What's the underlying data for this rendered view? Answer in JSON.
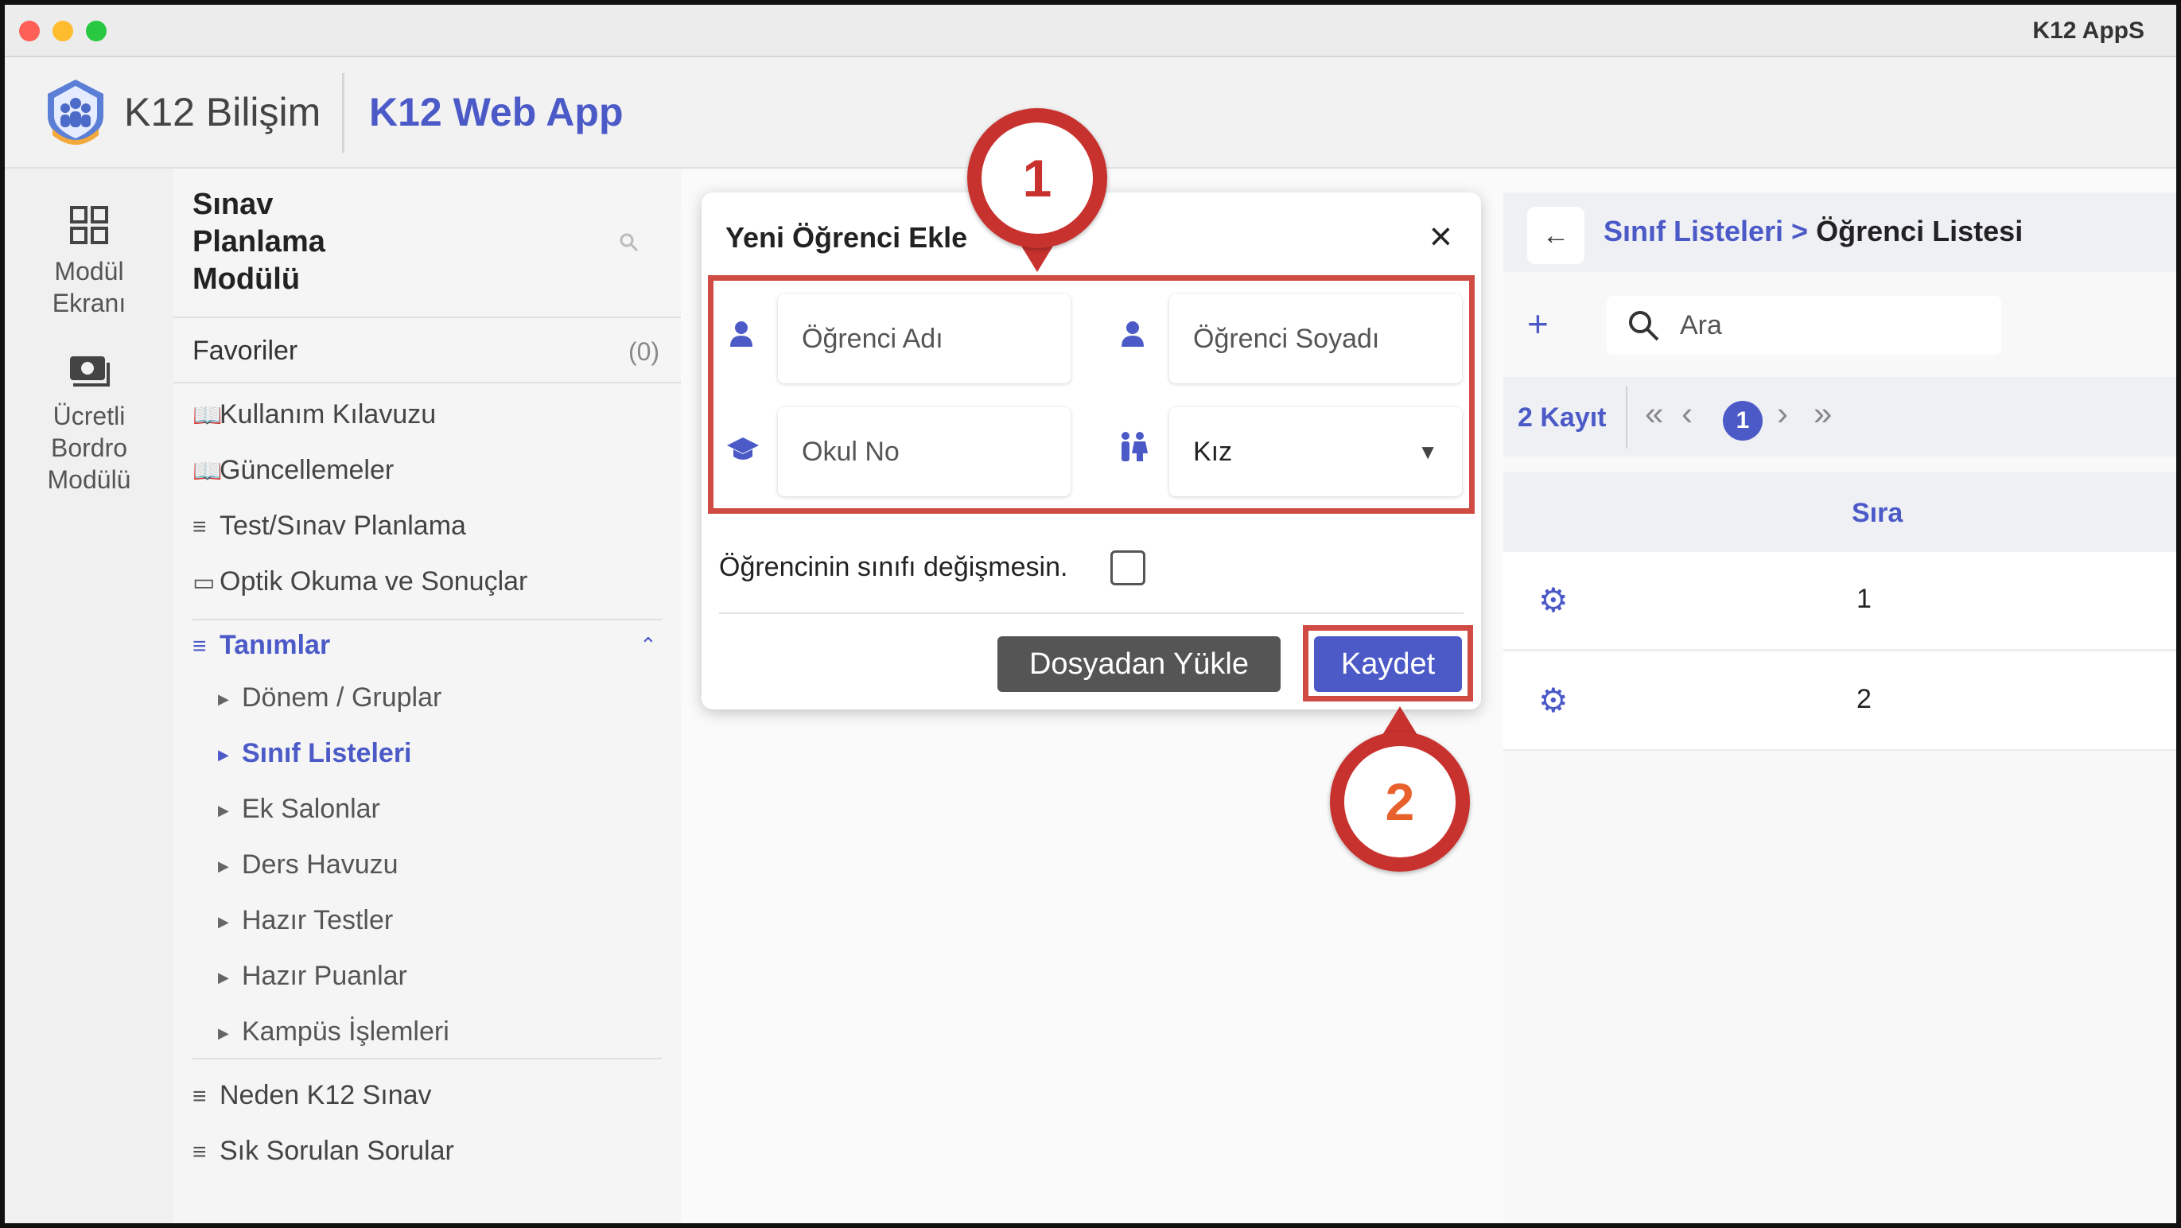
{
  "window": {
    "app_title": "K12 AppS",
    "traffic_lights": [
      "#fe5f57",
      "#febc2e",
      "#28c840"
    ]
  },
  "header": {
    "brand": "K12 Bilişim",
    "app_name": "K12 Web App"
  },
  "rail": {
    "items": [
      {
        "label_line1": "Modül",
        "label_line2": "Ekranı",
        "icon": "grid-icon"
      },
      {
        "label_line1": "Ücretli",
        "label_line2": "Bordro",
        "label_line3": "Modülü",
        "icon": "payroll-icon"
      }
    ]
  },
  "sidebar": {
    "title_line1": "Sınav",
    "title_line2": "Planlama",
    "title_line3": "Modülü",
    "favorites_label": "Favoriler",
    "favorites_count": "(0)",
    "items": [
      {
        "label": "Kullanım Kılavuzu"
      },
      {
        "label": "Güncellemeler"
      },
      {
        "label": "Test/Sınav Planlama"
      },
      {
        "label": "Optik Okuma ve Sonuçlar"
      }
    ],
    "section": {
      "label": "Tanımlar",
      "children": [
        {
          "label": "Dönem / Gruplar"
        },
        {
          "label": "Sınıf Listeleri"
        },
        {
          "label": "Ek Salonlar"
        },
        {
          "label": "Ders Havuzu"
        },
        {
          "label": "Hazır Testler"
        },
        {
          "label": "Hazır Puanlar"
        },
        {
          "label": "Kampüs İşlemleri"
        }
      ]
    },
    "bottom_items": [
      {
        "label": "Neden K12 Sınav"
      },
      {
        "label": "Sık Sorulan Sorular"
      }
    ]
  },
  "modal": {
    "title": "Yeni Öğrenci Ekle",
    "first_name_placeholder": "Öğrenci Adı",
    "last_name_placeholder": "Öğrenci Soyadı",
    "school_no_placeholder": "Okul No",
    "gender_value": "Kız",
    "checkbox_label": "Öğrencinin sınıfı değişmesin.",
    "upload_button": "Dosyadan Yükle",
    "save_button": "Kaydet"
  },
  "right_panel": {
    "crumb_parent": "Sınıf Listeleri >",
    "crumb_current": "Öğrenci Listesi",
    "search_placeholder": "Ara",
    "record_count": "2 Kayıt",
    "current_page": "1",
    "column_header": "Sıra",
    "rows": [
      {
        "sira": "1"
      },
      {
        "sira": "2"
      }
    ]
  },
  "annotations": {
    "pin1": "1",
    "pin2": "2"
  },
  "colors": {
    "accent": "#4c5ac8",
    "annotation_red": "#d14b45",
    "pin1_text": "#c8322e",
    "pin2_text": "#e8602c"
  }
}
